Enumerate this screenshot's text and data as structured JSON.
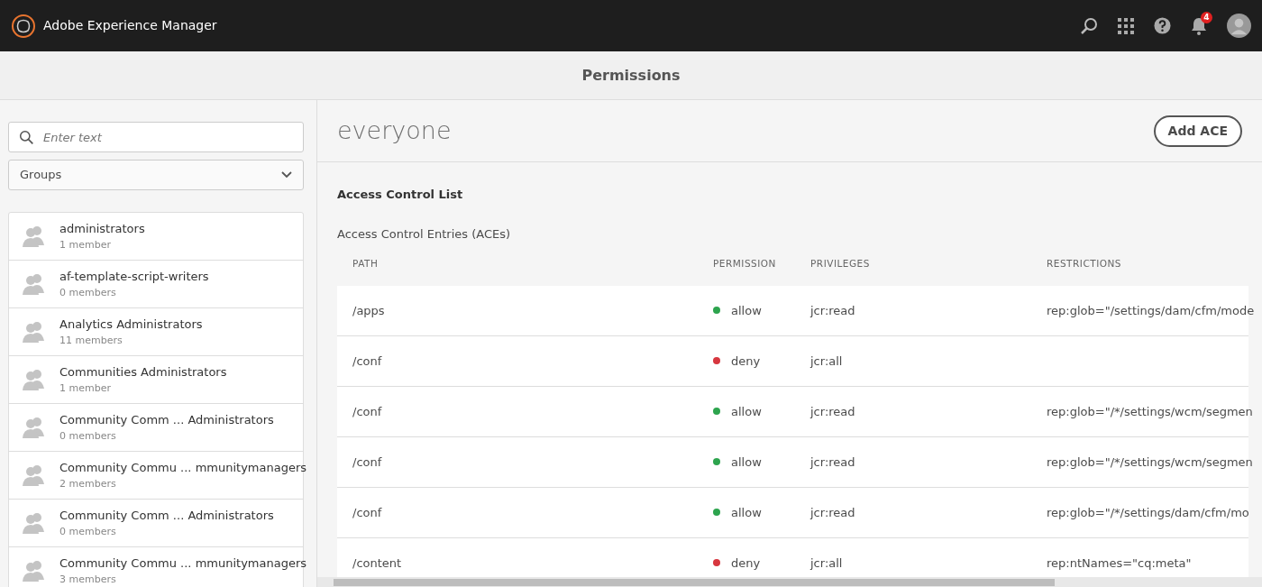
{
  "app_bar": {
    "title": "Adobe Experience Manager",
    "notification_count": "4"
  },
  "page_title": "Permissions",
  "sidebar": {
    "search": {
      "placeholder": "Enter text"
    },
    "filter": {
      "value": "Groups"
    },
    "groups": [
      {
        "name": "administrators",
        "members": "1 member"
      },
      {
        "name": "af-template-script-writers",
        "members": "0 members"
      },
      {
        "name": "Analytics Administrators",
        "members": "11 members"
      },
      {
        "name": "Communities Administrators",
        "members": "1 member"
      },
      {
        "name": "Community Comm ... Administrators",
        "members": "0 members"
      },
      {
        "name": "Community Commu ... mmunitymanagers",
        "members": "2 members"
      },
      {
        "name": "Community Comm ... Administrators",
        "members": "0 members"
      },
      {
        "name": "Community Commu ... mmunitymanagers",
        "members": "3 members"
      }
    ]
  },
  "detail": {
    "principal": "everyone",
    "add_button": "Add ACE",
    "section_title": "Access Control List",
    "table_title": "Access Control Entries (ACEs)",
    "table": {
      "columns": [
        "PATH",
        "PERMISSION",
        "PRIVILEGES",
        "RESTRICTIONS"
      ],
      "rows": [
        {
          "path": "/apps",
          "permission": "allow",
          "color": "#2da44e",
          "privileges": "jcr:read",
          "restrictions": "rep:glob=\"/settings/dam/cfm/mode"
        },
        {
          "path": "/conf",
          "permission": "deny",
          "color": "#d7373f",
          "privileges": "jcr:all"
        },
        {
          "path": "/conf",
          "permission": "allow",
          "color": "#2da44e",
          "privileges": "jcr:read",
          "restrictions": "rep:glob=\"/*/settings/wcm/segmen"
        },
        {
          "path": "/conf",
          "permission": "allow",
          "color": "#2da44e",
          "privileges": "jcr:read",
          "restrictions": "rep:glob=\"/*/settings/wcm/segmen"
        },
        {
          "path": "/conf",
          "permission": "allow",
          "color": "#2da44e",
          "privileges": "jcr:read",
          "restrictions": "rep:glob=\"/*/settings/dam/cfm/mo"
        },
        {
          "path": "/content",
          "permission": "deny",
          "color": "#d7373f",
          "privileges": "jcr:all",
          "restrictions": "rep:ntNames=\"cq:meta\""
        }
      ]
    }
  }
}
